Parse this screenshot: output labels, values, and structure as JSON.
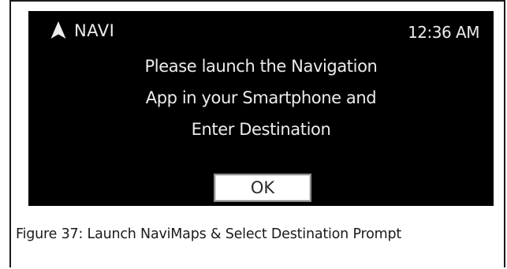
{
  "screen": {
    "app_icon": "navigation-arrow-icon",
    "app_title": "NAVI",
    "clock": "12:36 AM",
    "message_lines": [
      "Please launch the Navigation",
      "App in your Smartphone and",
      "Enter Destination"
    ],
    "ok_label": "OK"
  },
  "caption": "Figure 37: Launch NaviMaps & Select Destination Prompt",
  "colors": {
    "screen_background": "#000000",
    "screen_text": "#ececec",
    "button_background": "#ffffff",
    "button_border": "#8d8d8d"
  }
}
